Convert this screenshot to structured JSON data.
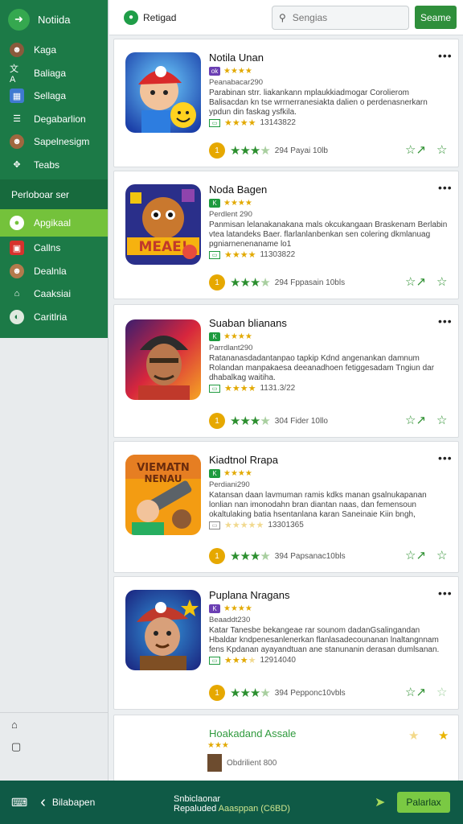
{
  "sidebar": {
    "app_name": "Notiida",
    "items": [
      {
        "label": "Kaga",
        "icon": "avatar-icon"
      },
      {
        "label": "Baliaga",
        "icon": "translate-icon"
      },
      {
        "label": "Sellaga",
        "icon": "calendar-icon"
      },
      {
        "label": "Degabarlion",
        "icon": "list-icon"
      },
      {
        "label": "Sapelnesigm",
        "icon": "avatar-icon"
      },
      {
        "label": "Teabs",
        "icon": "puzzle-icon"
      }
    ],
    "section_label": "Perloboar ser",
    "active_item": {
      "label": "Apgikaal",
      "icon": "chat-icon"
    },
    "sub_items": [
      {
        "label": "Callns",
        "icon": "game-icon"
      },
      {
        "label": "Dealnla",
        "icon": "avatar-icon"
      },
      {
        "label": "Caaksiai",
        "icon": "home-icon"
      },
      {
        "label": "Caritlria",
        "icon": "compass-icon"
      }
    ]
  },
  "topbar": {
    "tab_label": "Retigad",
    "search_placeholder": "Sengias",
    "button_label": "Seame"
  },
  "cards": [
    {
      "title": "Notila Unan",
      "badge": "ok",
      "badge_color": "#6b3fb3",
      "subtitle": "Peanabacar290",
      "description": "Parabinan strr. liakankann mplaukkiadmogar Corolierom Balisacdan kn tse wrrnerranesiakta dalien o perdenasnerkarn ypdun din faskag ysfkila.",
      "meta_value": "13143822",
      "rating_text": "294 Payai 10lb",
      "stars": 3.5
    },
    {
      "title": "Noda Bagen",
      "badge": "K",
      "badge_color": "#1e9a3e",
      "subtitle": "Perdlent 290",
      "description": "Panmisan lelanakanakana mals okcukangaan Braskenam Berlabin vtea latandeks Baer. flarlanlanbenkan sen colering dkmlanuag pgniarnenenaname lo1",
      "meta_value": "11303822",
      "rating_text": "294 Fppasain 10bls",
      "stars": 3.5
    },
    {
      "title": "Suaban blianans",
      "badge": "K",
      "badge_color": "#1e9a3e",
      "subtitle": "Parrdlant290",
      "description": "Ratananasdadantanpao tapkip Kdnd angenankan damnum Rolandan manpakaesa deeanadhoen fetiggesadam Tngiun dar dhabalkag waitiha.",
      "meta_value": "1131.3/22",
      "rating_text": "304 Fider 10llo",
      "stars": 3.5
    },
    {
      "title": "Kiadtnol Rrapa",
      "badge": "K",
      "badge_color": "#1e9a3e",
      "subtitle": "Perdiani290",
      "description": "Katansan daan lavmuman ramis kdks manan gsalnukapanan lonlian nan imonodahn bran diantan naas, dan femensoun okaltulaking batia hsentanlana karan Saneinaie Kiin bngh,",
      "meta_value": "13301365",
      "rating_text": "394 Papsanac10bls",
      "stars": 3.5
    },
    {
      "title": "Puplana Nragans",
      "badge": "K",
      "badge_color": "#6b3fb3",
      "subtitle": "Beaaddt230",
      "description": "Katar Tanesbe bekangeae rar sounom dadanGsalingandan Hbaldar kndpenesanlenerkan flanlasadecounanan lnaltangnnam fens Kpdanan ayayandtuan ane stanunanin derasan dumlsanan.",
      "meta_value": "12914040",
      "rating_text": "394 Pepponc10vbls",
      "stars": 3.5
    }
  ],
  "partial_card": {
    "title": "Hoakadand Assale",
    "subtitle": "Obdrilient 800"
  },
  "bottombar": {
    "back_label": "Bilabapen",
    "info_title": "Snbiclaonar",
    "info_sub_a": "Repaluded",
    "info_sub_b": "Aaasppan (C6BD)",
    "button_label": "Palarlax"
  },
  "colors": {
    "sidebar_green": "#1c7a47",
    "active_green": "#74c23b",
    "bottom_bar": "#0f5a46",
    "primary_button": "#2f8f3b",
    "star_gold": "#e2a900",
    "star_green": "#2c8f2f"
  }
}
